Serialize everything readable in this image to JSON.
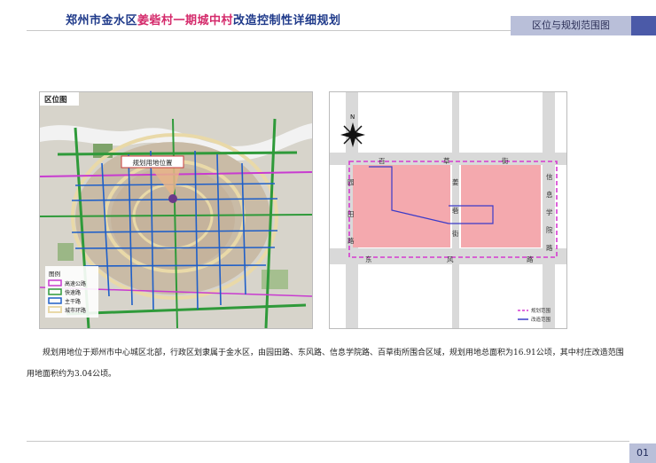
{
  "header": {
    "title_segments": [
      "郑州市金水区",
      "姜砦村一期城中村",
      "改造控制性详细规划"
    ],
    "section_label": "区位与规划范围图",
    "colors": {
      "title": "#1f3a8a",
      "highlight": "#d42a6b",
      "tab_bg": "#b9bfd9",
      "tab_accent": "#4b5aa8"
    }
  },
  "location_map": {
    "panel_label": "区位图",
    "site_marker_label": "规划用地位置",
    "legend": {
      "title": "图例",
      "items": [
        {
          "label": "高速公路",
          "color": "#c83bd0"
        },
        {
          "label": "快速路",
          "color": "#2f9a3a"
        },
        {
          "label": "主干路",
          "color": "#1f5fc8"
        },
        {
          "label": "城市环路",
          "color": "#e9d9a8"
        }
      ]
    }
  },
  "site_plan": {
    "north_label": "N",
    "roads": {
      "north": [
        "百",
        "草",
        "街"
      ],
      "west": [
        "园",
        "田",
        "路"
      ],
      "middle": [
        "姜",
        "砦",
        "街"
      ],
      "east": [
        "信",
        "息",
        "学",
        "院",
        "路"
      ],
      "south": [
        "东",
        "风",
        "路"
      ]
    },
    "legend": [
      {
        "label": "规划范围",
        "color": "#d63ad0"
      },
      {
        "label": "改造范围",
        "color": "#3a3ac8"
      }
    ]
  },
  "description": "规划用地位于郑州市中心城区北部，行政区划隶属于金水区，由园田路、东风路、信息学院路、百草街所围合区域，规划用地总面积为16.91公顷，其中村庄改造范围用地面积约为3.04公顷。",
  "page_number": "01"
}
